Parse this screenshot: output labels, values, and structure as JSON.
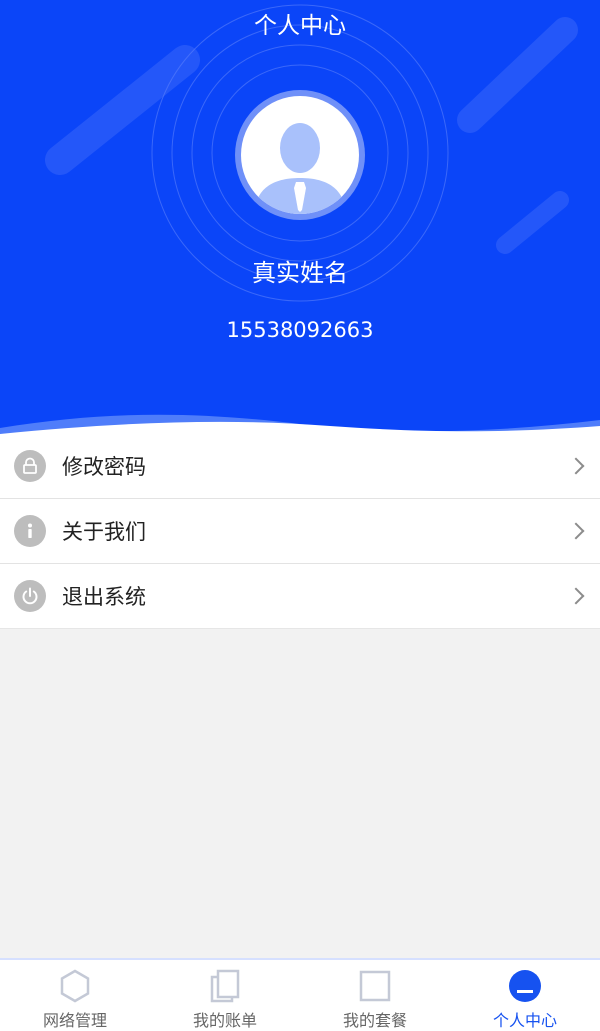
{
  "header": {
    "title": "个人中心",
    "bg_color": "#0b45f8"
  },
  "profile": {
    "name": "真实姓名",
    "phone": "15538092663",
    "avatar_icon": "user-avatar-icon"
  },
  "menu": {
    "items": [
      {
        "label": "修改密码",
        "icon": "lock-icon"
      },
      {
        "label": "关于我们",
        "icon": "info-icon"
      },
      {
        "label": "退出系统",
        "icon": "power-icon"
      }
    ]
  },
  "tabbar": {
    "active_color": "#1652f0",
    "items": [
      {
        "label": "网络管理",
        "icon": "hexagon-icon",
        "active": false
      },
      {
        "label": "我的账单",
        "icon": "documents-icon",
        "active": false
      },
      {
        "label": "我的套餐",
        "icon": "square-icon",
        "active": false
      },
      {
        "label": "个人中心",
        "icon": "person-icon",
        "active": true
      }
    ]
  }
}
